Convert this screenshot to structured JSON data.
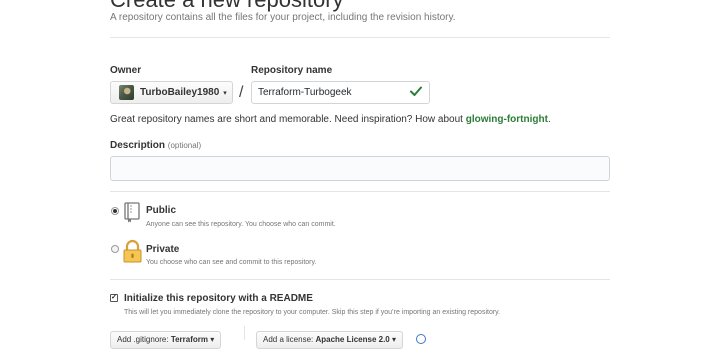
{
  "header": {
    "title": "Create a new repository",
    "subtitle": "A repository contains all the files for your project, including the revision history."
  },
  "owner": {
    "label": "Owner",
    "name": "TurboBailey1980",
    "caret": "▾"
  },
  "separator": "/",
  "repo": {
    "label": "Repository name",
    "value": "Terraform-Turbogeek",
    "valid": true
  },
  "hint": {
    "prefix": "Great repository names are short and memorable. Need inspiration? How about ",
    "suggestion": "glowing-fortnight",
    "suffix": "."
  },
  "description": {
    "label": "Description",
    "optional": "(optional)",
    "value": ""
  },
  "visibility": {
    "selected": "public",
    "public": {
      "title": "Public",
      "desc": "Anyone can see this repository. You choose who can commit.",
      "icon": "repo-book-icon"
    },
    "private": {
      "title": "Private",
      "desc": "You choose who can see and commit to this repository.",
      "icon": "lock-icon"
    }
  },
  "init": {
    "checked": true,
    "label": "Initialize this repository with a README",
    "desc": "This will let you immediately clone the repository to your computer. Skip this step if you’re importing an existing repository."
  },
  "gitignore": {
    "prefix": "Add .gitignore: ",
    "value": "Terraform",
    "caret": "▾"
  },
  "license": {
    "prefix": "Add a license: ",
    "value": "Apache License 2.0",
    "caret": "▾"
  },
  "colors": {
    "success": "#2c7d37",
    "link": "#4078c0",
    "border": "#d1d5da"
  }
}
